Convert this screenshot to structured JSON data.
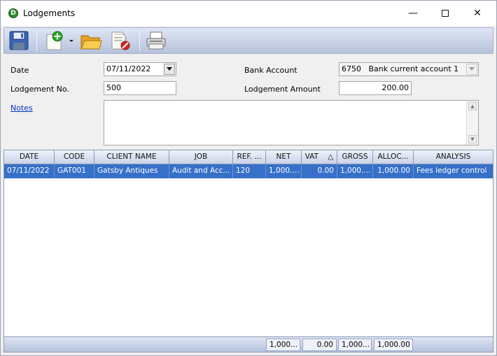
{
  "window": {
    "title": "Lodgements",
    "app_icon_letter": "D",
    "minimize_glyph": "—",
    "close_glyph": "✕"
  },
  "toolbar": {
    "buttons": [
      {
        "name": "save",
        "icon": "floppy-disk-icon"
      },
      {
        "name": "new",
        "icon": "new-document-plus-icon"
      },
      {
        "name": "new-dropdown",
        "icon": "dropdown-arrow-icon"
      },
      {
        "name": "open",
        "icon": "open-folder-icon"
      },
      {
        "name": "delete",
        "icon": "delete-document-icon"
      },
      {
        "name": "print",
        "icon": "printer-icon"
      }
    ]
  },
  "form": {
    "date_label": "Date",
    "date_value": "07/11/2022",
    "lodgement_no_label": "Lodgement No.",
    "lodgement_no_value": "500",
    "notes_label": "Notes",
    "notes_value": "",
    "bank_account_label": "Bank Account",
    "bank_account_code": "6750",
    "bank_account_name": "Bank current account 1",
    "lodgement_amount_label": "Lodgement Amount",
    "lodgement_amount_value": "200.00"
  },
  "grid": {
    "columns": [
      "DATE",
      "CODE",
      "CLIENT NAME",
      "JOB",
      "REF. ...",
      "NET",
      "VAT",
      "GROSS",
      "ALLOC...",
      "ANALYSIS"
    ],
    "sort_column": "VAT",
    "sort_glyph": "△",
    "rows": [
      {
        "date": "07/11/2022",
        "code": "GAT001",
        "client_name": "Gatsby Antiques",
        "job": "Audit and Acc...",
        "ref": "120",
        "net": "1,000....",
        "vat": "0.00",
        "gross": "1,000....",
        "alloc": "1,000.00",
        "analysis": "Fees ledger control"
      }
    ],
    "totals": {
      "net": "1,000...",
      "vat": "0.00",
      "gross": "1,000...",
      "alloc": "1,000.00"
    }
  },
  "colors": {
    "selected_row": "#3670c9",
    "link": "#0033cc",
    "toolbar_gradient_top": "#dfe6f4",
    "toolbar_gradient_bottom": "#b6c2dc"
  }
}
